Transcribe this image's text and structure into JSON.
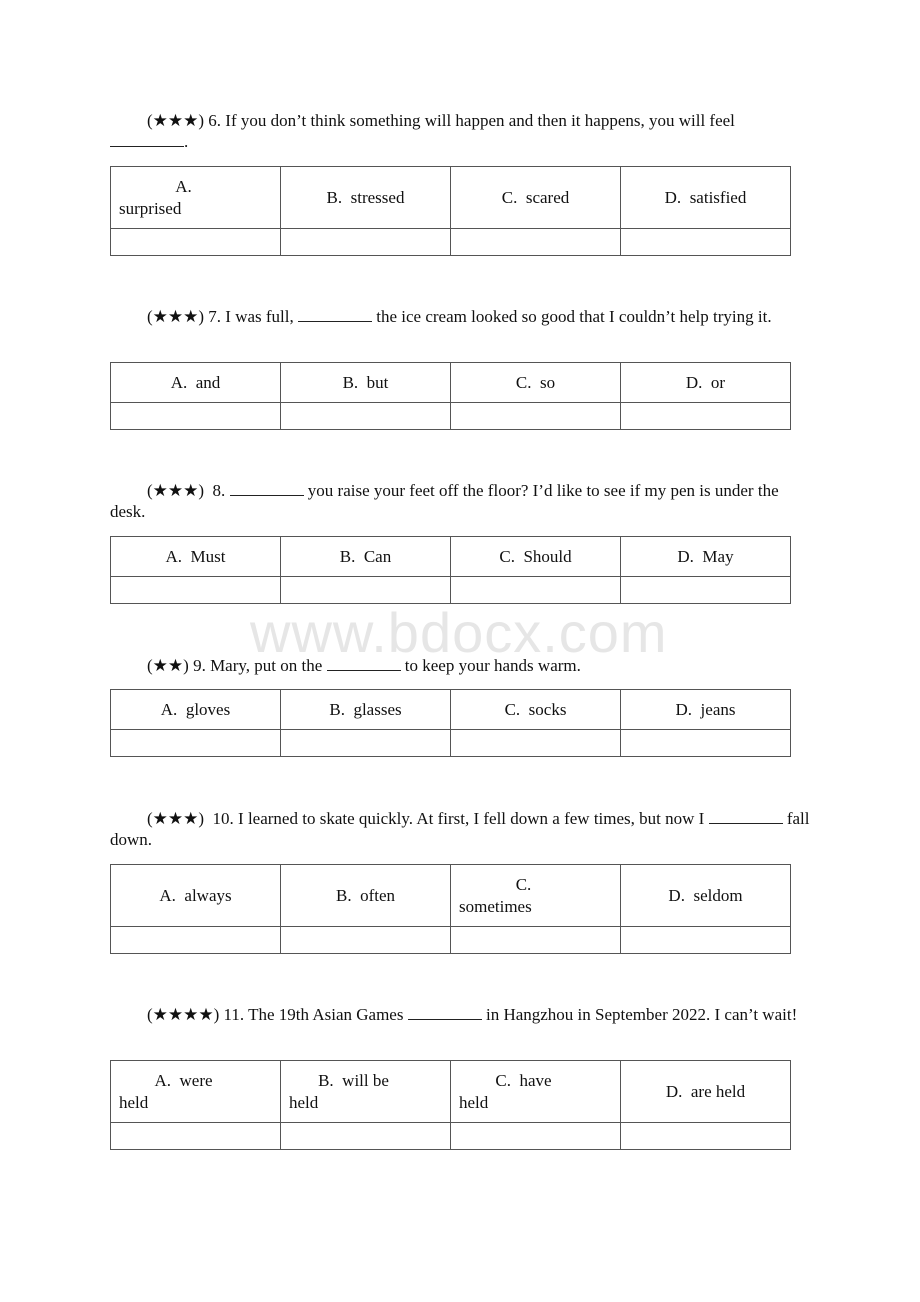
{
  "watermark": "www.bdocx.com",
  "questions": [
    {
      "rating": "(★★★)",
      "number": "6.",
      "before": "If you don’t think something will happen and then it happens, you will feel",
      "after": ".",
      "options": [
        {
          "letter": "A.",
          "text": "surprised"
        },
        {
          "letter": "B.",
          "text": "stressed"
        },
        {
          "letter": "C.",
          "text": "scared"
        },
        {
          "letter": "D.",
          "text": "satisfied"
        }
      ]
    },
    {
      "rating": "(★★★)",
      "number": "7.",
      "before": "I was full,",
      "after": "the ice cream looked so good that I couldn’t help trying it.",
      "options": [
        {
          "letter": "A.",
          "text": "and"
        },
        {
          "letter": "B.",
          "text": "but"
        },
        {
          "letter": "C.",
          "text": "so"
        },
        {
          "letter": "D.",
          "text": "or"
        }
      ]
    },
    {
      "rating": "(★★★)",
      "number": "8.",
      "before": "",
      "after": "you raise your feet off the floor? I’d like to see if my pen is under the desk.",
      "options": [
        {
          "letter": "A.",
          "text": "Must"
        },
        {
          "letter": "B.",
          "text": "Can"
        },
        {
          "letter": "C.",
          "text": "Should"
        },
        {
          "letter": "D.",
          "text": "May"
        }
      ]
    },
    {
      "rating": "(★★)",
      "number": "9.",
      "before": "Mary, put on the",
      "after": "to keep your hands warm.",
      "options": [
        {
          "letter": "A.",
          "text": "gloves"
        },
        {
          "letter": "B.",
          "text": "glasses"
        },
        {
          "letter": "C.",
          "text": "socks"
        },
        {
          "letter": "D.",
          "text": "jeans"
        }
      ]
    },
    {
      "rating": "(★★★)",
      "number": "10.",
      "before": "I learned to skate quickly. At first, I fell down a few times, but now I",
      "after": "fall down.",
      "options": [
        {
          "letter": "A.",
          "text": "always"
        },
        {
          "letter": "B.",
          "text": "often"
        },
        {
          "letter": "C.",
          "text": "sometimes"
        },
        {
          "letter": "D.",
          "text": "seldom"
        }
      ]
    },
    {
      "rating": "(★★★★)",
      "number": "11.",
      "before": "The 19th Asian Games",
      "after": "in Hangzhou in September 2022. I can’t wait!",
      "options": [
        {
          "letter": "A.",
          "text": "were held",
          "l1": "were",
          "l2": "held"
        },
        {
          "letter": "B.",
          "text": "will be held",
          "l1": "will be",
          "l2": "held"
        },
        {
          "letter": "C.",
          "text": "have held",
          "l1": "have",
          "l2": "held"
        },
        {
          "letter": "D.",
          "text": "are held"
        }
      ]
    }
  ]
}
